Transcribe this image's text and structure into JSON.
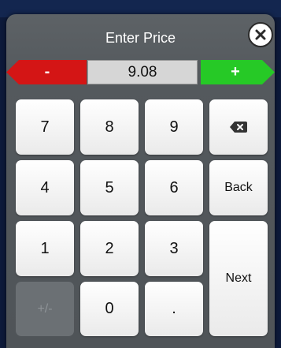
{
  "dialog": {
    "title": "Enter Price",
    "close_icon": "close-icon"
  },
  "price": {
    "value": "9.08",
    "decrement_label": "-",
    "increment_label": "+"
  },
  "keypad": {
    "row1": [
      "7",
      "8",
      "9"
    ],
    "row2": [
      "4",
      "5",
      "6"
    ],
    "row3": [
      "1",
      "2",
      "3"
    ],
    "row4": [
      "+/-",
      "0",
      "."
    ],
    "backspace_icon": "backspace-icon",
    "back_label": "Back",
    "next_label": "Next"
  },
  "colors": {
    "minus_red": "#d41515",
    "plus_green": "#26c926"
  }
}
